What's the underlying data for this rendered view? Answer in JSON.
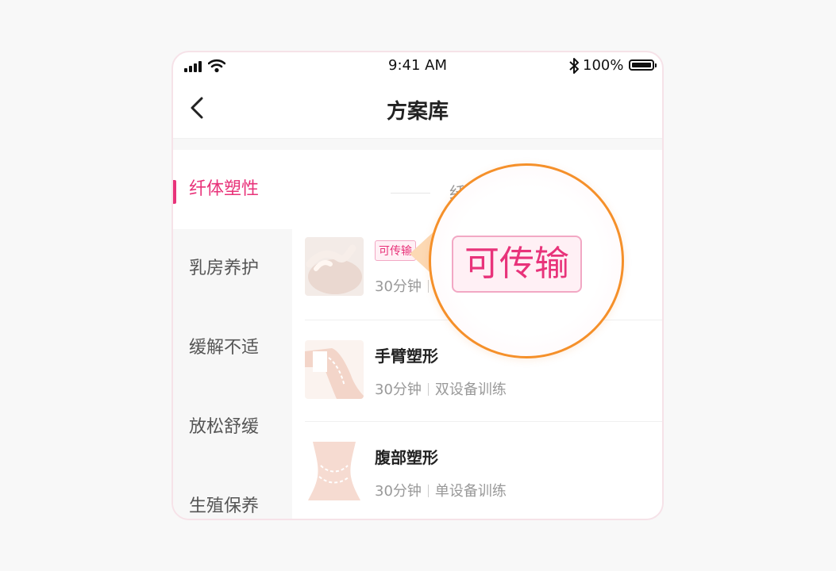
{
  "status_bar": {
    "time": "9:41 AM",
    "battery": "100%"
  },
  "nav": {
    "title": "方案库"
  },
  "sidebar": {
    "items": [
      {
        "label": "纤体塑性",
        "active": true
      },
      {
        "label": "乳房养护",
        "active": false
      },
      {
        "label": "缓解不适",
        "active": false
      },
      {
        "label": "放松舒缓",
        "active": false
      },
      {
        "label": "生殖保养",
        "active": false
      }
    ]
  },
  "content": {
    "section_title": "纤",
    "cards": [
      {
        "tag": "可传输",
        "duration": "30分钟"
      },
      {
        "title": "手臂塑形",
        "duration": "30分钟",
        "mode": "双设备训练"
      },
      {
        "title": "腹部塑形",
        "duration": "30分钟",
        "mode": "单设备训练"
      }
    ]
  },
  "callout": {
    "tag_label": "可传输"
  },
  "colors": {
    "accent": "#e8337a",
    "callout_ring": "#f5902a"
  },
  "icons": [
    "cellular-signal-icon",
    "wifi-icon",
    "bluetooth-icon",
    "battery-icon",
    "back-chevron-icon"
  ]
}
